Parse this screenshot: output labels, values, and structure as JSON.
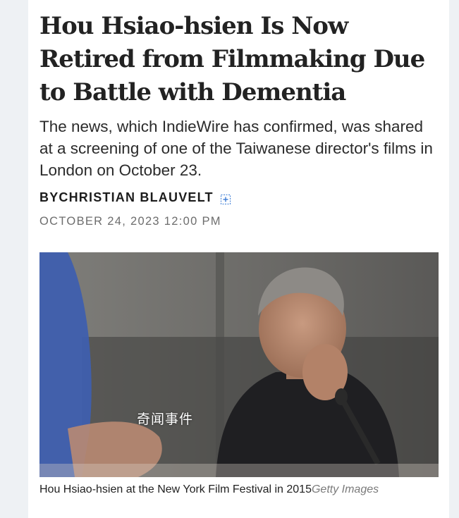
{
  "article": {
    "headline": "Hou Hsiao-hsien Is Now Retired from Filmmaking Due to Battle with Dementia",
    "dek": "The news, which IndieWire has confirmed, was shared at a screening of one of the Taiwanese director's films in London on October 23.",
    "byline_prefix": "BY ",
    "author": "CHRISTIAN BLAUVELT",
    "date": "OCTOBER 24, 2023 12:00 PM"
  },
  "image": {
    "watermark": "奇闻事件",
    "caption": "Hou Hsiao-hsien at the New York Film Festival in 2015",
    "credit": "Getty Images"
  },
  "icons": {
    "author_expand": "expand-plus-icon"
  },
  "colors": {
    "headline": "#222222",
    "byline": "#1c1c1c",
    "date": "#6d6d6d",
    "credit": "#7a7a7a",
    "icon": "#3a7bd5"
  }
}
